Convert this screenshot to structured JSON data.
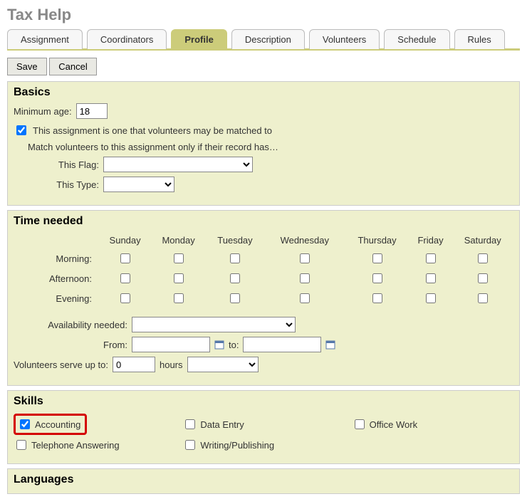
{
  "title": "Tax Help",
  "tabs": [
    "Assignment",
    "Coordinators",
    "Profile",
    "Description",
    "Volunteers",
    "Schedule",
    "Rules"
  ],
  "active_tab": "Profile",
  "buttons": {
    "save": "Save",
    "cancel": "Cancel"
  },
  "basics": {
    "heading": "Basics",
    "min_age_label": "Minimum age:",
    "min_age_value": "18",
    "matchable_label": "This assignment is one that volunteers may be matched to",
    "matchable_checked": true,
    "match_intro": "Match volunteers to this assignment only if their record has…",
    "flag_label": "This Flag:",
    "flag_value": "",
    "type_label": "This Type:",
    "type_value": ""
  },
  "time": {
    "heading": "Time needed",
    "days": [
      "Sunday",
      "Monday",
      "Tuesday",
      "Wednesday",
      "Thursday",
      "Friday",
      "Saturday"
    ],
    "periods": [
      "Morning:",
      "Afternoon:",
      "Evening:"
    ],
    "avail_label": "Availability needed:",
    "avail_value": "",
    "from_label": "From:",
    "from_value": "",
    "to_label": "to:",
    "to_value": "",
    "serve_label": "Volunteers serve up to:",
    "serve_hours_value": "0",
    "serve_unit_label": "hours",
    "serve_unit_value": ""
  },
  "skills": {
    "heading": "Skills",
    "items": [
      {
        "label": "Accounting",
        "checked": true,
        "highlight": true
      },
      {
        "label": "Data Entry",
        "checked": false,
        "highlight": false
      },
      {
        "label": "Office Work",
        "checked": false,
        "highlight": false
      },
      {
        "label": "Telephone Answering",
        "checked": false,
        "highlight": false
      },
      {
        "label": "Writing/Publishing",
        "checked": false,
        "highlight": false
      }
    ]
  },
  "languages": {
    "heading": "Languages"
  }
}
